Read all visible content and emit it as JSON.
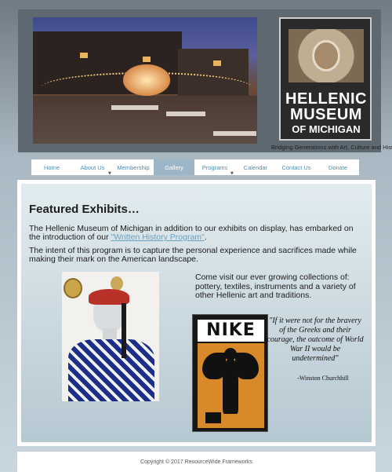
{
  "header": {
    "logo": {
      "line1": "HELLENIC",
      "line2": "MUSEUM",
      "line3": "OF MICHIGAN"
    },
    "tagline": "Bridging Generations with Art, Culture and History"
  },
  "nav": {
    "items": [
      {
        "label": "Home",
        "active": false,
        "has_submenu": false
      },
      {
        "label": "About Us",
        "active": false,
        "has_submenu": true
      },
      {
        "label": "Membership",
        "active": false,
        "has_submenu": false
      },
      {
        "label": "Gallery",
        "active": true,
        "has_submenu": false
      },
      {
        "label": "Programs",
        "active": false,
        "has_submenu": true
      },
      {
        "label": "Calendar",
        "active": false,
        "has_submenu": false
      },
      {
        "label": "Contact Us",
        "active": false,
        "has_submenu": false
      },
      {
        "label": "Donate",
        "active": false,
        "has_submenu": false
      }
    ],
    "arrow": "▼"
  },
  "main": {
    "title": "Featured Exhibits…",
    "intro_before_link": "The Hellenic Museum of Michigan in addition to our exhibits on display, has embarked on the introduction of our ",
    "intro_link": "\"Written History Program\"",
    "intro_after_link": ".",
    "intent": "The intent of this program is to capture the personal experience and sacrifices made while making their mark on the American landscape.",
    "visit": "Come visit our ever growing collections of: pottery, textiles, instruments and a variety of other Hellenic art and traditions.",
    "book_title": "NIKE",
    "quote": "\"If it were not for the bravery of the Greeks and their courage, the outcome of World War II would be undetermined\"",
    "quote_author": "-Winston Churchhill"
  },
  "footer": {
    "copyright": "Copyright © 2017 ResourceWide Frameworks"
  },
  "colors": {
    "nav_active_bg": "#9cb6c8",
    "nav_link": "#4c8fb0",
    "link": "#6a9fc0"
  }
}
